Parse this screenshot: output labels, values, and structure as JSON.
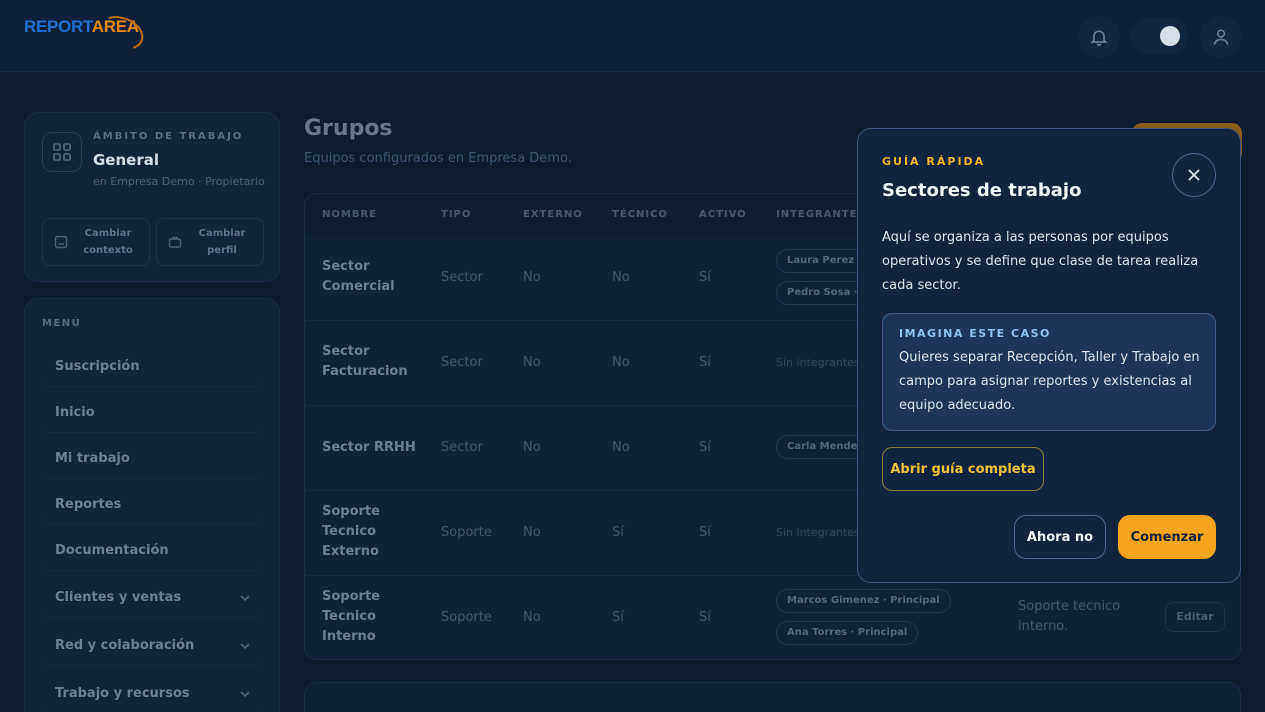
{
  "brand": {
    "part1": "REPORT",
    "part2": "AREA"
  },
  "topbar": {
    "notifications_icon": "bell-icon",
    "theme_icon": "moon-icon",
    "profile_icon": "user-icon"
  },
  "context": {
    "kicker": "ÁMBITO DE TRABAJO",
    "title": "General",
    "subtitle": "en Empresa Demo · Propietario",
    "change_context": "Cambiar contexto",
    "change_profile": "Cambiar perfil"
  },
  "menu": {
    "kicker": "MENÚ",
    "items": [
      {
        "label": "Suscripción",
        "has_chevron": false
      },
      {
        "label": "Inicio",
        "has_chevron": false
      },
      {
        "label": "Mi trabajo",
        "has_chevron": false
      },
      {
        "label": "Reportes",
        "has_chevron": false
      },
      {
        "label": "Documentación",
        "has_chevron": false
      },
      {
        "label": "Clientes y ventas",
        "has_chevron": true
      },
      {
        "label": "Red y colaboración",
        "has_chevron": true
      },
      {
        "label": "Trabajo y recursos",
        "has_chevron": true
      }
    ]
  },
  "page": {
    "title": "Grupos",
    "subtitle": "Equipos configurados en Empresa Demo."
  },
  "table": {
    "headers": [
      "NOMBRE",
      "TIPO",
      "EXTERNO",
      "TÉCNICO",
      "ACTIVO",
      "INTEGRANTES"
    ],
    "rows": [
      {
        "name": "Sector Comercial",
        "tipo": "Sector",
        "externo": "No",
        "tecnico": "No",
        "activo": "Sí",
        "members": [
          "Laura Perez ·",
          "Pedro Sosa ·"
        ]
      },
      {
        "name": "Sector Facturacion",
        "tipo": "Sector",
        "externo": "No",
        "tecnico": "No",
        "activo": "Sí",
        "empty": "Sin integrantes"
      },
      {
        "name": "Sector RRHH",
        "tipo": "Sector",
        "externo": "No",
        "tecnico": "No",
        "activo": "Sí",
        "members": [
          "Carla Mendez"
        ]
      },
      {
        "name": "Soporte Tecnico Externo",
        "tipo": "Soporte",
        "externo": "No",
        "tecnico": "Sí",
        "activo": "Sí",
        "empty": "Sin integrantes"
      },
      {
        "name": "Soporte Tecnico Interno",
        "tipo": "Soporte",
        "externo": "No",
        "tecnico": "Sí",
        "activo": "Sí",
        "members": [
          "Marcos Gimenez · Principal",
          "Ana Torres · Principal"
        ],
        "description": "Soporte tecnico interno.",
        "edit": "Editar"
      }
    ]
  },
  "modal": {
    "kicker": "GUÍA RÁPIDA",
    "title": "Sectores de trabajo",
    "body": "Aquí se organiza a las personas por equipos operativos y se define que clase de tarea realiza cada sector.",
    "case_kicker": "IMAGINA ESTE CASO",
    "case_text": "Quieres separar Recepción, Taller y Trabajo en campo para asignar reportes y existencias al equipo adecuado.",
    "guide_button": "Abrir guía completa",
    "later_button": "Ahora no",
    "start_button": "Comenzar"
  }
}
